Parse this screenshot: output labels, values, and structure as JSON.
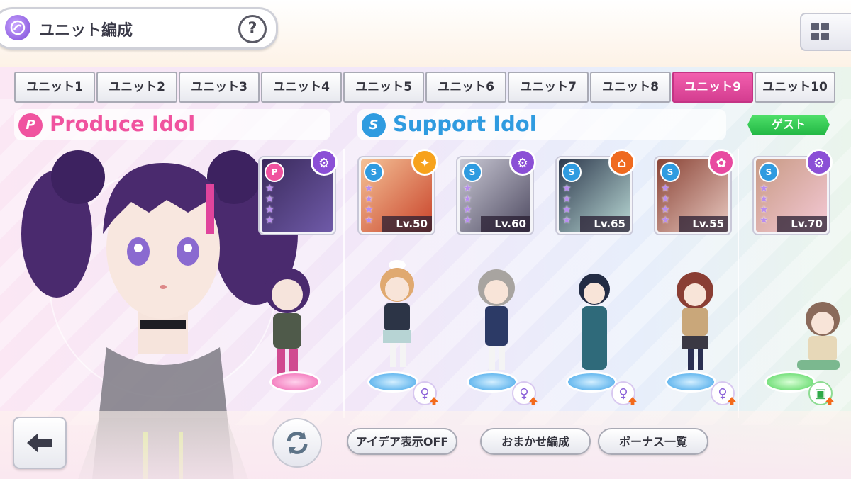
{
  "header": {
    "title": "ユニット編成",
    "help_label": "?"
  },
  "tabs": [
    {
      "label": "ユニット1",
      "active": false
    },
    {
      "label": "ユニット2",
      "active": false
    },
    {
      "label": "ユニット3",
      "active": false
    },
    {
      "label": "ユニット4",
      "active": false
    },
    {
      "label": "ユニット5",
      "active": false
    },
    {
      "label": "ユニット6",
      "active": false
    },
    {
      "label": "ユニット7",
      "active": false
    },
    {
      "label": "ユニット8",
      "active": false
    },
    {
      "label": "ユニット9",
      "active": true
    },
    {
      "label": "ユニット10",
      "active": false
    }
  ],
  "produce": {
    "title": "Produce Idol",
    "icon_letter": "P",
    "accent": "#f0539f"
  },
  "support": {
    "title": "Support Idol",
    "icon_letter": "S",
    "accent": "#2f9be0",
    "guest_label": "ゲスト"
  },
  "produce_card": {
    "type": "P",
    "stars": 4,
    "corner_icon": "gear-icon",
    "palette": [
      "#3a2a5c",
      "#6f5aa8"
    ]
  },
  "support_cards": [
    {
      "type": "S",
      "stars": 4,
      "level": "Lv.50",
      "corner_icon": "sparkle-icon",
      "corner_color": "#f7a21c",
      "palette": [
        "#f4c196",
        "#c9442b"
      ]
    },
    {
      "type": "S",
      "stars": 4,
      "level": "Lv.60",
      "corner_icon": "gear-icon",
      "corner_color": "#8b4fd6",
      "palette": [
        "#c8c7d3",
        "#4f4b62"
      ]
    },
    {
      "type": "S",
      "stars": 4,
      "level": "Lv.65",
      "corner_icon": "school-icon",
      "corner_color": "#ef6a1f",
      "palette": [
        "#2f3a4e",
        "#b8d8d4"
      ]
    },
    {
      "type": "S",
      "stars": 4,
      "level": "Lv.55",
      "corner_icon": "flower-icon",
      "corner_color": "#e84aa0",
      "palette": [
        "#8a4436",
        "#e8c8c0"
      ]
    },
    {
      "type": "S",
      "stars": 4,
      "level": "Lv.70",
      "corner_icon": "gear-icon",
      "corner_color": "#8b4fd6",
      "palette": [
        "#c89a84",
        "#f4c9d6"
      ]
    }
  ],
  "buttons": {
    "idea_toggle": "アイデア表示OFF",
    "auto_form": "おまかせ編成",
    "bonus_list": "ボーナス一覧"
  }
}
